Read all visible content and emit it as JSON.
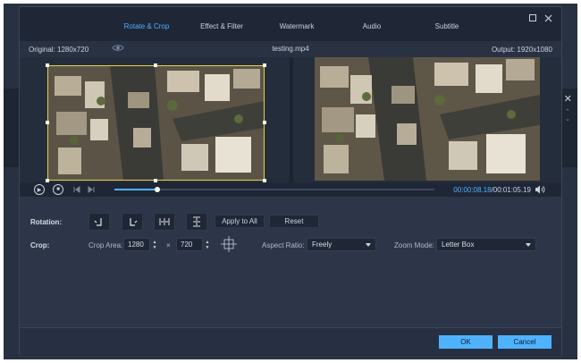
{
  "tabs": [
    {
      "label": "Rotate & Crop",
      "active": true
    },
    {
      "label": "Effect & Filter",
      "active": false
    },
    {
      "label": "Watermark",
      "active": false
    },
    {
      "label": "Audio",
      "active": false
    },
    {
      "label": "Subtitle",
      "active": false
    }
  ],
  "info": {
    "original": "Original: 1280x720",
    "filename": "testing.mp4",
    "output": "Output: 1920x1080"
  },
  "player": {
    "current_time": "00:00:08.18",
    "total_time": "/00:01:05.19",
    "progress": 0.135
  },
  "rotation": {
    "label": "Rotation:",
    "apply_all": "Apply to All",
    "reset": "Reset"
  },
  "crop": {
    "label": "Crop:",
    "area_label": "Crop Area:",
    "width": "1280",
    "times": "×",
    "height": "720",
    "aspect_label": "Aspect Ratio:",
    "aspect_value": "Freely",
    "zoom_label": "Zoom Mode:",
    "zoom_value": "Letter Box"
  },
  "footer": {
    "ok": "OK",
    "cancel": "Cancel"
  },
  "colors": {
    "accent": "#4fb2ff",
    "crop_border": "#e6d34a",
    "dialog_bg": "#2c3648"
  }
}
